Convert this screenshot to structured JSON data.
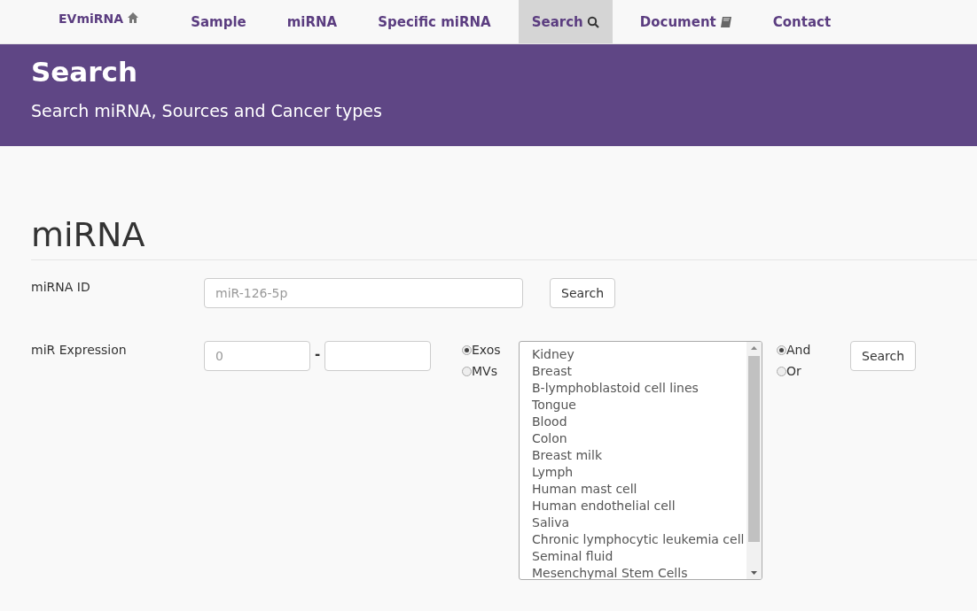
{
  "navbar": {
    "items": [
      {
        "label": "EVmiRNA",
        "kind": "brand",
        "selected": false
      },
      {
        "label": "Sample",
        "kind": "link",
        "selected": false
      },
      {
        "label": "miRNA",
        "kind": "link",
        "selected": false
      },
      {
        "label": "Specific miRNA",
        "kind": "link",
        "selected": false
      },
      {
        "label": "Search",
        "kind": "search",
        "selected": true
      },
      {
        "label": "Document",
        "kind": "document",
        "selected": false
      },
      {
        "label": "Contact",
        "kind": "link",
        "selected": false
      }
    ]
  },
  "banner": {
    "title": "Search",
    "subtitle": "Search miRNA, Sources and Cancer types"
  },
  "section": {
    "heading": "miRNA",
    "id_row": {
      "label": "miRNA ID",
      "placeholder": "miR-126-5p",
      "button": "Search"
    },
    "expression_row": {
      "label": "miR Expression",
      "min_placeholder": "0",
      "separator": "-",
      "vesicle_options": [
        {
          "label": "Exos",
          "selected": true
        },
        {
          "label": "MVs",
          "selected": false
        }
      ],
      "sources": [
        "Kidney",
        "Breast",
        "B-lymphoblastoid cell lines",
        "Tongue",
        "Blood",
        "Colon",
        "Breast milk",
        "Lymph",
        "Human mast cell",
        "Human endothelial cell",
        "Saliva",
        "Chronic lymphocytic leukemia cell",
        "Seminal fluid",
        "Mesenchymal Stem Cells"
      ],
      "logic_options": [
        {
          "label": "And",
          "selected": true
        },
        {
          "label": "Or",
          "selected": false
        }
      ],
      "button": "Search"
    }
  }
}
